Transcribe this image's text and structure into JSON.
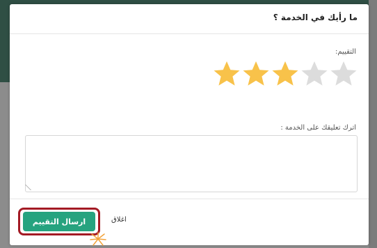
{
  "modal": {
    "title": "ما رأيك في الخدمة ؟"
  },
  "rating": {
    "label": "التقييم:",
    "value": 3,
    "max": 5,
    "filled_color": "#f8c24a",
    "empty_color": "#dcdcdc"
  },
  "comment": {
    "label": "اترك تعليقك على الخدمة :",
    "value": ""
  },
  "footer": {
    "submit_label": "ارسال التقييم",
    "close_label": "اغلاق",
    "submit_color": "#26a37f",
    "highlight_color": "#a31a24"
  },
  "icons": {
    "star": "star-icon",
    "cursor": "click-burst-icon"
  }
}
